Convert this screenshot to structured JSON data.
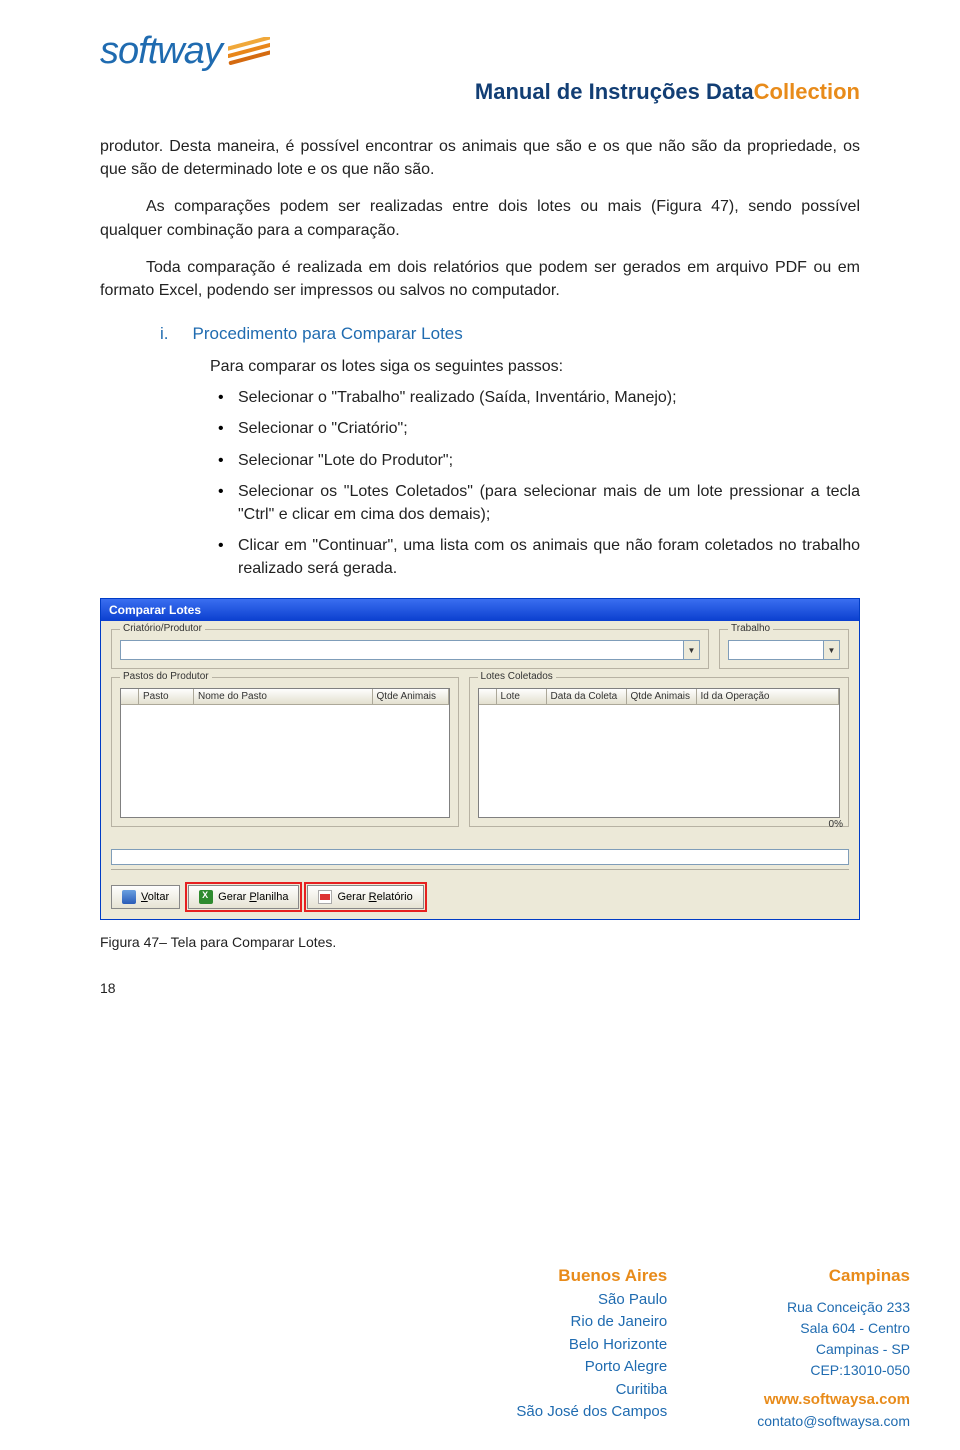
{
  "logo": {
    "text": "softway"
  },
  "doc_title": {
    "prefix": "Manual de Instruções Data",
    "accent": "Collection"
  },
  "paragraphs": {
    "p1": "produtor. Desta maneira, é possível encontrar os animais que são e os que não são da propriedade, os que são de determinado lote e os que não são.",
    "p2": "As comparações podem ser realizadas entre dois lotes ou mais (Figura 47), sendo possível qualquer combinação para a comparação.",
    "p3": "Toda comparação é realizada em dois relatórios que podem ser gerados em arquivo PDF ou em formato Excel, podendo ser impressos ou salvos no computador."
  },
  "section": {
    "num": "i.",
    "title": "Procedimento para Comparar Lotes"
  },
  "intro_sub": "Para comparar os lotes siga os seguintes passos:",
  "bullets": [
    "Selecionar o \"Trabalho\" realizado (Saída, Inventário, Manejo);",
    "Selecionar o \"Criatório\";",
    "Selecionar \"Lote do Produtor\";",
    "Selecionar os \"Lotes Coletados\" (para selecionar mais de um lote pressionar a tecla \"Ctrl\" e clicar em cima dos demais);",
    "Clicar em \"Continuar\", uma lista com os animais que não foram coletados no trabalho realizado será gerada."
  ],
  "app": {
    "title": "Comparar Lotes",
    "groups": {
      "criatorio": "Criatório/Produtor",
      "trabalho": "Trabalho",
      "pastos": "Pastos do Produtor",
      "lotes": "Lotes Coletados"
    },
    "grid_pastos_cols": [
      "",
      "Pasto",
      "Nome do Pasto",
      "Qtde Animais"
    ],
    "grid_lotes_cols": [
      "",
      "Lote",
      "Data da Coleta",
      "Qtde Animais",
      "Id da Operação"
    ],
    "progress_label": "0%",
    "buttons": {
      "voltar": "Voltar",
      "planilha": "Gerar Planilha",
      "relatorio": "Gerar Relatório"
    }
  },
  "caption": "Figura 47– Tela para Comparar Lotes.",
  "page_number": "18",
  "footer": {
    "cities": [
      "Buenos Aires",
      "São Paulo",
      "Rio de Janeiro",
      "Belo Horizonte",
      "Porto Alegre",
      "Curitiba",
      "São José dos Campos"
    ],
    "campinas": {
      "city": "Campinas",
      "addr": [
        "Rua Conceição 233",
        "Sala 604 - Centro",
        "Campinas - SP",
        "CEP:13010-050"
      ],
      "site": "www.softwaysa.com",
      "email": "contato@softwaysa.com"
    }
  }
}
